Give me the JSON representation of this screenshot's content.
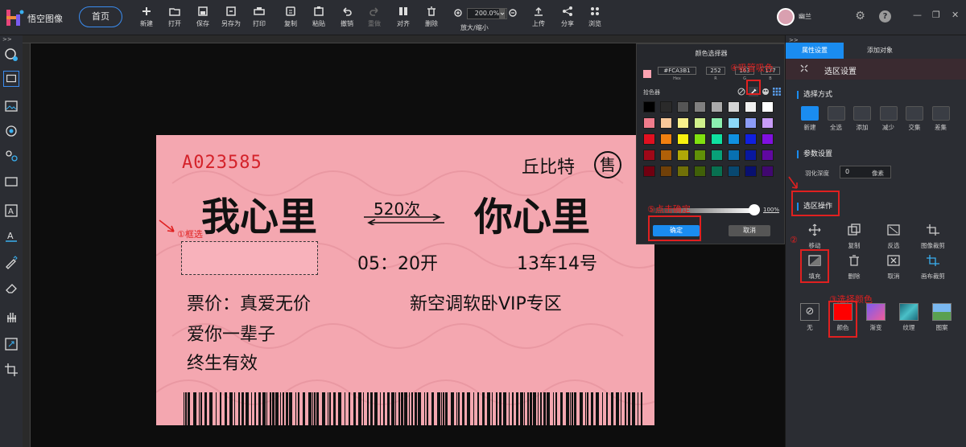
{
  "app": {
    "name": "悟空图像",
    "home": "首页"
  },
  "toolbar": [
    {
      "label": "新建",
      "icon": "plus-icon"
    },
    {
      "label": "打开",
      "icon": "folder-icon"
    },
    {
      "label": "保存",
      "icon": "save-icon"
    },
    {
      "label": "另存为",
      "icon": "save-as-icon"
    },
    {
      "label": "打印",
      "icon": "print-icon"
    },
    {
      "label": "复制",
      "icon": "copy-icon"
    },
    {
      "label": "粘贴",
      "icon": "paste-icon"
    },
    {
      "label": "撤销",
      "icon": "undo-icon"
    },
    {
      "label": "重做",
      "icon": "redo-icon",
      "disabled": true
    },
    {
      "label": "对齐",
      "icon": "align-icon"
    },
    {
      "label": "删除",
      "icon": "trash-icon"
    }
  ],
  "zoom": {
    "value": "200.0%",
    "label": "放大/缩小"
  },
  "toolbar_right": [
    {
      "label": "上传",
      "icon": "upload-icon"
    },
    {
      "label": "分享",
      "icon": "share-icon"
    },
    {
      "label": "浏览",
      "icon": "grid-icon"
    }
  ],
  "user": {
    "name": "幽兰"
  },
  "collapse": ">>",
  "ticket": {
    "serial": "A023585",
    "station_small": "丘比特",
    "sale_mark": "售",
    "from": "我心里",
    "train": "520次",
    "to": "你心里",
    "time": "05：20开",
    "car": "13车14号",
    "price": "票价：真爱无价",
    "seat": "新空调软卧VIP专区",
    "line1": "爱你一辈子",
    "line2": "终生有效"
  },
  "annotations": {
    "select_box": "①框选",
    "step2": "②",
    "select_color": "③选择颜色",
    "eyedropper": "④吸管吸色",
    "confirm": "⑤点击确定"
  },
  "color_picker": {
    "title": "颜色选择器",
    "hex": "#FCA3B1",
    "r": "252",
    "g": "163",
    "b": "177",
    "hex_label": "Hex",
    "r_label": "R",
    "g_label": "G",
    "b_label": "B",
    "picker_label": "拾色器",
    "opacity": "100%",
    "ok": "确定",
    "cancel": "取消",
    "swatches": [
      [
        "#000000",
        "#2a2a2a",
        "#555555",
        "#808080",
        "#aaaaaa",
        "#d4d4d4",
        "#f0f0f0",
        "#ffffff"
      ],
      [
        "#f07c8c",
        "#f8c89a",
        "#f8f08c",
        "#d0f08c",
        "#8cf0b0",
        "#8cd8f8",
        "#8c9cf8",
        "#c89cf8"
      ],
      [
        "#e01020",
        "#f08010",
        "#f8f010",
        "#80e010",
        "#10e0a0",
        "#1090e0",
        "#1020e0",
        "#8010e0"
      ],
      [
        "#a00818",
        "#b06008",
        "#b0a808",
        "#609008",
        "#08a078",
        "#0870b0",
        "#0818a0",
        "#6008a0"
      ],
      [
        "#700010",
        "#704008",
        "#707008",
        "#406008",
        "#087050",
        "#084870",
        "#081070",
        "#400870"
      ]
    ]
  },
  "right_panel": {
    "tabs": [
      "属性设置",
      "添加对象"
    ],
    "header": "选区设置",
    "mode_title": "选择方式",
    "modes": [
      "新建",
      "全选",
      "添加",
      "减少",
      "交集",
      "差集"
    ],
    "params_title": "参数设置",
    "feather_label": "羽化深度",
    "feather_value": "0",
    "feather_unit": "像素",
    "ops_title": "选区操作",
    "ops": [
      "移动",
      "复制",
      "反选",
      "图像裁剪",
      "填充",
      "删除",
      "取消",
      "画布裁剪"
    ],
    "fills": [
      "无",
      "颜色",
      "渐变",
      "纹理",
      "图案"
    ]
  },
  "colors": {
    "accent": "#1a8cf0",
    "ticket_bg": "#f4a7b0",
    "annotation": "#e02020"
  }
}
